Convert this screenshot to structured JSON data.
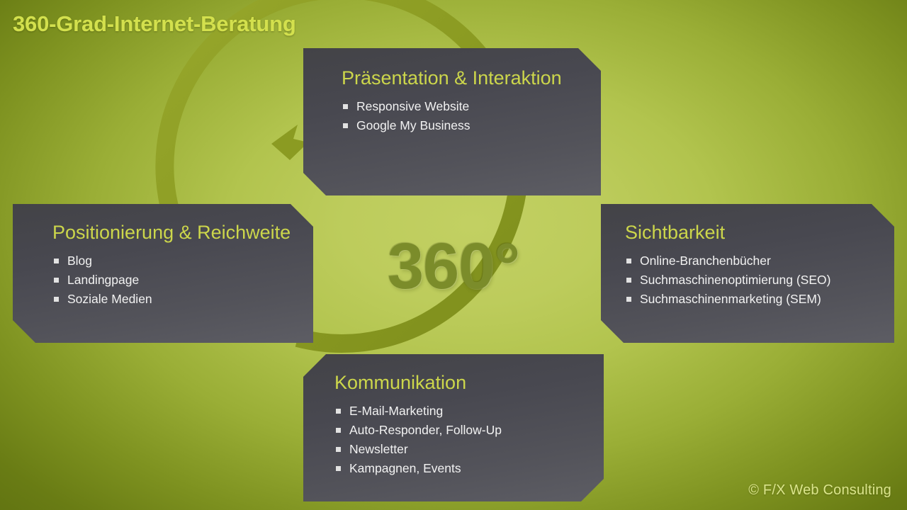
{
  "slide": {
    "title": "360-Grad-Internet-Beratung",
    "center_label": "360°",
    "footer": "© F/X Web Consulting",
    "colors": {
      "background_center": "#c2d062",
      "background_edge": "#5d6f10",
      "panel_fill": "#4a4a50",
      "heading": "#ccd64b",
      "body_text": "#f2f2f2",
      "title": "#d3e04d",
      "ring": "#8d9d24",
      "center_number": "#7b8c2a",
      "footer": "#dbe58c"
    }
  },
  "ring": {
    "name": "clockwise-cycle-arrow-ring",
    "direction": "clockwise",
    "arrowhead_count": 1
  },
  "panels": {
    "top": {
      "id": "praesentation-interaktion",
      "heading": "Präsentation & Interaktion",
      "items": [
        "Responsive Website",
        "Google My Business"
      ]
    },
    "left": {
      "id": "positionierung-reichweite",
      "heading": "Positionierung & Reichweite",
      "items": [
        "Blog",
        "Landingpage",
        "Soziale Medien"
      ]
    },
    "right": {
      "id": "sichtbarkeit",
      "heading": "Sichtbarkeit",
      "items": [
        "Online-Branchenbücher",
        "Suchmaschinenoptimierung (SEO)",
        "Suchmaschinenmarketing (SEM)"
      ]
    },
    "bottom": {
      "id": "kommunikation",
      "heading": "Kommunikation",
      "items": [
        "E-Mail-Marketing",
        "Auto-Responder, Follow-Up",
        "Newsletter",
        "Kampagnen, Events"
      ]
    }
  }
}
